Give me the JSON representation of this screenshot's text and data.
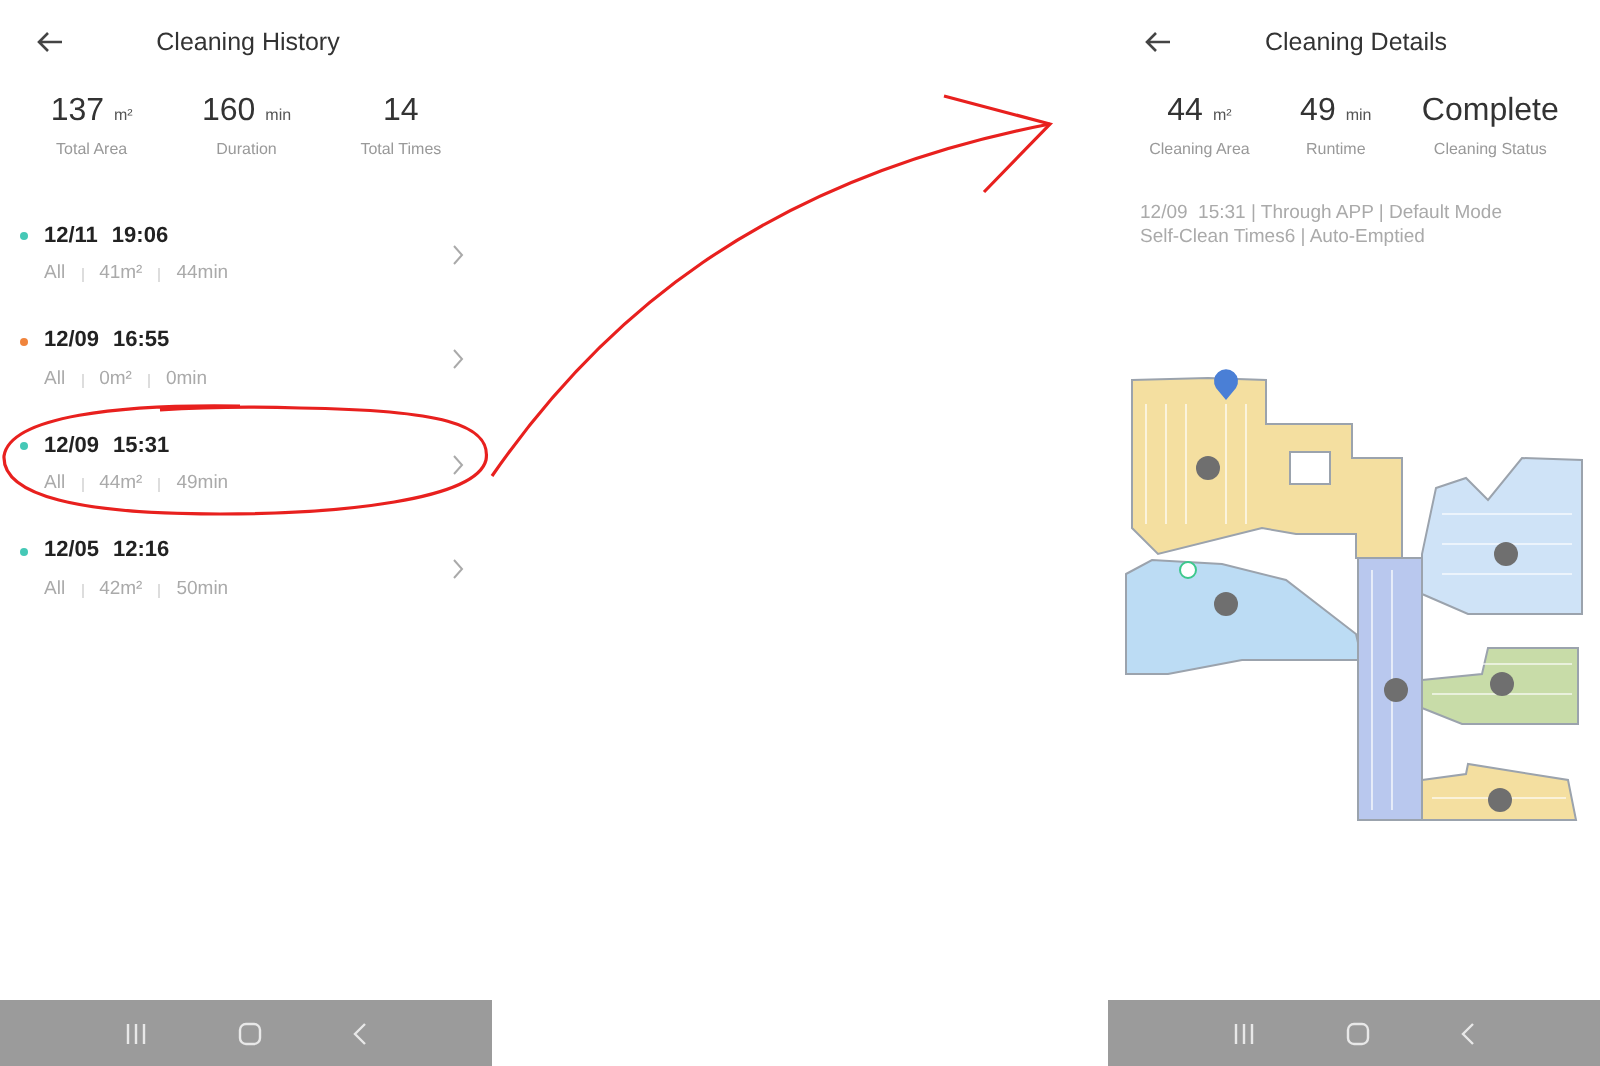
{
  "history_screen": {
    "title": "Cleaning History",
    "stats": [
      {
        "value": "137",
        "unit": "m²",
        "label": "Total Area"
      },
      {
        "value": "160",
        "unit": "min",
        "label": "Duration"
      },
      {
        "value": "14",
        "label": "Total Times"
      }
    ],
    "records": [
      {
        "date": "12/11",
        "time": "19:06",
        "color": "#45c8b6",
        "mode": "All",
        "area": "41m²",
        "duration": "44min",
        "circled": false
      },
      {
        "date": "12/09",
        "time": "16:55",
        "color": "#f0843c",
        "mode": "All",
        "area": "0m²",
        "duration": "0min",
        "circled": false
      },
      {
        "date": "12/09",
        "time": "15:31",
        "color": "#45c8b6",
        "mode": "All",
        "area": "44m²",
        "duration": "49min",
        "circled": true
      },
      {
        "date": "12/05",
        "time": "12:16",
        "color": "#45c8b6",
        "mode": "All",
        "area": "42m²",
        "duration": "50min",
        "circled": false
      }
    ]
  },
  "details_screen": {
    "title": "Cleaning Details",
    "stats": [
      {
        "value": "44",
        "unit": "m²",
        "label": "Cleaning Area"
      },
      {
        "value": "49",
        "unit": "min",
        "label": "Runtime"
      },
      {
        "value": "Complete",
        "label": "Cleaning Status"
      }
    ],
    "summary_lines": [
      "12/09  15:31 | Through APP | Default Mode",
      "Self-Clean Times6 | Auto-Emptied"
    ]
  }
}
